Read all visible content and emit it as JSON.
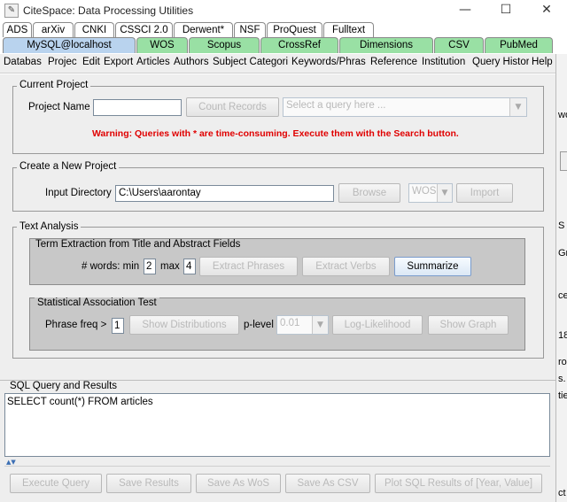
{
  "window": {
    "title": "CiteSpace: Data Processing Utilities",
    "minimize": "—",
    "maximize": "☐",
    "close": "✕"
  },
  "tabs_row1": [
    "ADS",
    "arXiv",
    "CNKI",
    "CSSCI 2.0",
    "Derwent*",
    "NSF",
    "ProQuest",
    "Fulltext"
  ],
  "tabs_row2": [
    "MySQL@localhost",
    "WOS",
    "Scopus",
    "CrossRef",
    "Dimensions",
    "CSV",
    "PubMed"
  ],
  "menu": [
    "Databas",
    "Projec",
    "Edit",
    "Export",
    "Articles",
    "Authors",
    "Subject Categori",
    "Keywords/Phras",
    "Reference",
    "Institution",
    "Query Histor",
    "Help"
  ],
  "current_project": {
    "title": "Current Project",
    "project_name_label": "Project Name",
    "project_name_value": "",
    "count_records": "Count Records",
    "query_placeholder": "Select a query here ...",
    "warning": "Warning: Queries with * are time-consuming. Execute them with the Search button."
  },
  "new_project": {
    "title": "Create a New Project",
    "input_dir_label": "Input Directory",
    "input_dir_value": "C:\\Users\\aarontay",
    "browse": "Browse",
    "source": "WOS",
    "import": "Import"
  },
  "text_analysis": {
    "title": "Text Analysis",
    "term_extraction": {
      "title": "Term Extraction from Title and Abstract Fields",
      "words_min_label": "# words: min",
      "min_value": "2",
      "max_label": "max",
      "max_value": "4",
      "extract_phrases": "Extract Phrases",
      "extract_verbs": "Extract Verbs",
      "summarize": "Summarize"
    },
    "stat_test": {
      "title": "Statistical Association Test",
      "phrase_freq_label": "Phrase freq >",
      "phrase_freq_value": "1",
      "show_distributions": "Show Distributions",
      "p_level_label": "p-level",
      "p_level_value": "0.01",
      "log_likelihood": "Log-Likelihood",
      "show_graph": "Show Graph"
    }
  },
  "sql": {
    "title": "SQL Query and Results",
    "query": "SELECT count(*) FROM articles",
    "execute": "Execute Query",
    "save_results": "Save Results",
    "save_as_wos": "Save As WoS",
    "save_as_csv": "Save As CSV",
    "plot": "Plot SQL Results of [Year, Value]"
  },
  "right_strip": [
    "wo",
    "S",
    "Gr",
    "ce",
    "18",
    "ro",
    "s.",
    "tie",
    "ct"
  ],
  "colors": {
    "tab_row1": "#ffffff",
    "tab_row2_green": "#99e0a4",
    "tab_selected_blue": "#b9d3ee",
    "warning_red": "#e00000",
    "panel_bg": "#eeeeee"
  }
}
